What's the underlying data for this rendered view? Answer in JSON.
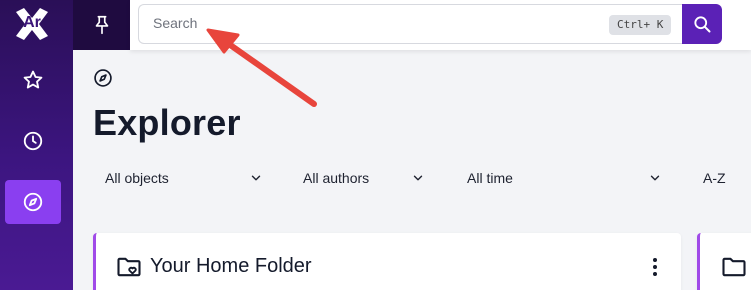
{
  "sidebar": {
    "logo_text": "Ar",
    "items": [
      {
        "name": "favorites",
        "icon": "star-icon",
        "active": false
      },
      {
        "name": "recent",
        "icon": "clock-icon",
        "active": false
      },
      {
        "name": "explorer",
        "icon": "compass-icon",
        "active": true
      }
    ]
  },
  "topbar": {
    "pin_icon": "pin-icon",
    "search": {
      "placeholder": "Search",
      "shortcut": "Ctrl+ K",
      "button_icon": "search-icon"
    }
  },
  "page": {
    "icon": "compass-icon",
    "title": "Explorer",
    "filters": [
      {
        "label": "All objects"
      },
      {
        "label": "All authors"
      },
      {
        "label": "All time"
      },
      {
        "label": "A-Z"
      }
    ]
  },
  "cards": [
    {
      "title": "Your Home Folder",
      "icon": "folder-heart-icon"
    },
    {
      "title": "",
      "icon": "folder-icon"
    }
  ],
  "colors": {
    "sidebar": "#3c1580",
    "accent": "#5b21b6",
    "active": "#8a3ff0",
    "card_border": "#a04ae8",
    "annotation_arrow": "#e8453c"
  }
}
